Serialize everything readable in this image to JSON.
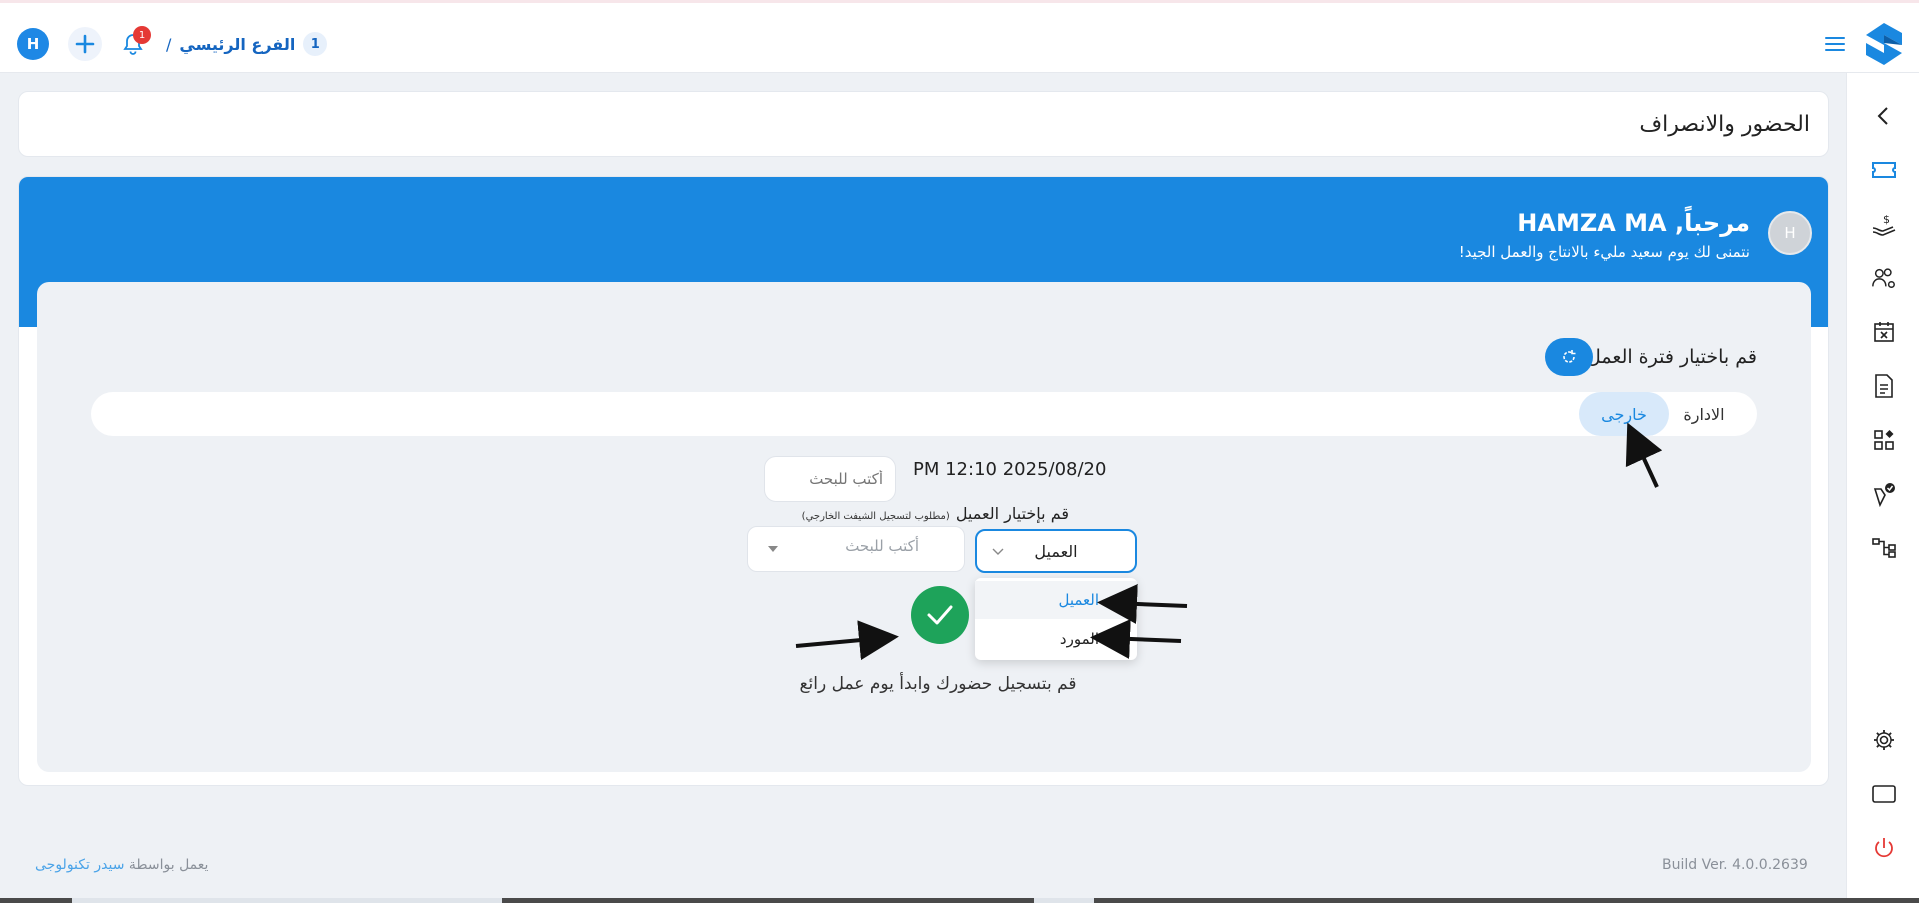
{
  "header": {
    "avatar_initial": "H",
    "notification_count": "1",
    "branch_number": "1",
    "branch_name": "الفرع الرئيسي",
    "branch_separator": "/"
  },
  "page": {
    "title": "الحضور والانصراف"
  },
  "welcome": {
    "avatar_initial": "H",
    "greeting": "مرحباً, HAMZA MA",
    "subtitle": "نتمنى لك يوم سعيد مليء بالانتاج والعمل الجيد!"
  },
  "work_period": {
    "label": "قم باختيار فترة العمل",
    "tabs": [
      "الادارة",
      "خارجى"
    ],
    "active_tab": "خارجى"
  },
  "datetime": "PM 12:10 2025/08/20",
  "search_top": {
    "placeholder": "أكتب للبحث"
  },
  "client": {
    "label": "قم بإختيار العميل",
    "note": "(مطلوب لتسجيل الشيفت الخارجي)",
    "selected": "العميل",
    "options": [
      "العميل",
      "المورد"
    ],
    "search_placeholder": "أكتب للبحث"
  },
  "attendance_message": "قم بتسجيل حضورك وابدأ يوم عمل رائع",
  "footer": {
    "build": "Build Ver. 4.0.0.2639",
    "powered_prefix": "يعمل بواسطة",
    "powered_link": "سيدر تكنولوجى"
  },
  "colors": {
    "primary": "#1a88e0",
    "success": "#1ea35a",
    "danger": "#e53935"
  },
  "sidebar_icons": [
    "chevron-left-icon",
    "ticket-icon",
    "hand-money-icon",
    "users-gear-icon",
    "calendar-x-icon",
    "document-icon",
    "apps-icon",
    "pen-check-icon",
    "hierarchy-icon",
    "settings-icon",
    "screen-icon",
    "power-icon"
  ]
}
